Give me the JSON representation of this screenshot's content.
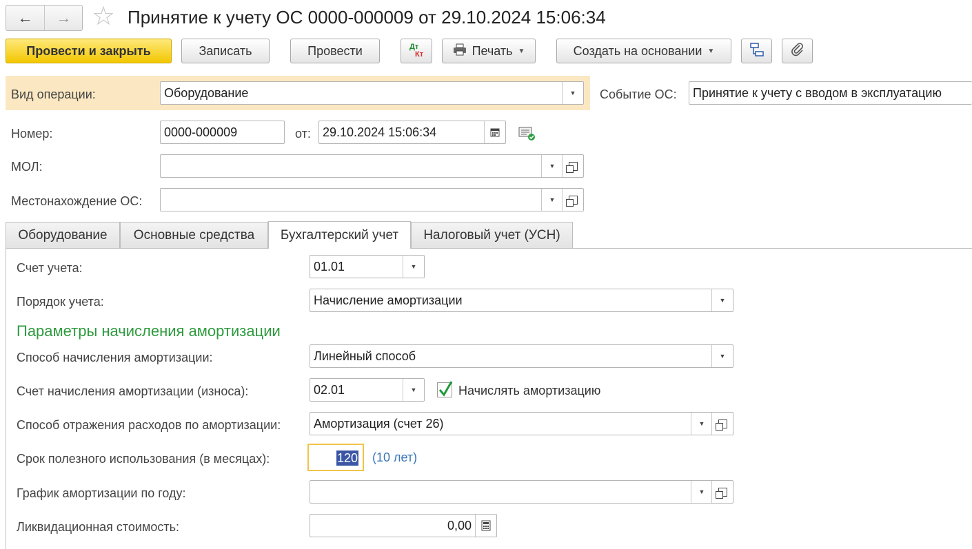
{
  "header": {
    "title": "Принятие к учету ОС 0000-000009 от 29.10.2024 15:06:34",
    "back_icon": "arrow-left-icon",
    "forward_icon": "arrow-right-icon",
    "favorite_icon": "star-icon"
  },
  "toolbar": {
    "post_close": "Провести и закрыть",
    "save": "Записать",
    "post": "Провести",
    "dtkt_dt": "Дт",
    "dtkt_kt": "Кт",
    "print": "Печать",
    "create_based": "Создать на основании"
  },
  "fields": {
    "operation_label": "Вид операции:",
    "operation_value": "Оборудование",
    "event_label": "Событие ОС:",
    "event_value": "Принятие к учету с вводом в эксплуатацию",
    "number_label": "Номер:",
    "number_value": "0000-000009",
    "date_label": "от:",
    "date_value": "29.10.2024 15:06:34",
    "mol_label": "МОЛ:",
    "mol_value": "",
    "location_label": "Местонахождение ОС:",
    "location_value": ""
  },
  "tabs": [
    "Оборудование",
    "Основные средства",
    "Бухгалтерский учет",
    "Налоговый учет (УСН)"
  ],
  "accounting": {
    "account_label": "Счет учета:",
    "account_value": "01.01",
    "order_label": "Порядок учета:",
    "order_value": "Начисление амортизации",
    "section_title": "Параметры начисления амортизации",
    "method_label": "Способ начисления амортизации:",
    "method_value": "Линейный способ",
    "depr_account_label": "Счет начисления амортизации (износа):",
    "depr_account_value": "02.01",
    "accrue_label": "Начислять амортизацию",
    "accrue_checked": true,
    "expense_label": "Способ отражения расходов по амортизации:",
    "expense_value": "Амортизация (счет 26)",
    "term_label": "Срок полезного использования (в месяцах):",
    "term_value": "120",
    "term_years": "(10 лет)",
    "schedule_label": "График амортизации по году:",
    "schedule_value": "",
    "liquidation_label": "Ликвидационная стоимость:",
    "liquidation_value": "0,00"
  },
  "colors": {
    "primary_button": "#f2c700",
    "highlight": "#fbe8c2",
    "section_title": "#2e9b3e",
    "years_text": "#3a76b8"
  }
}
